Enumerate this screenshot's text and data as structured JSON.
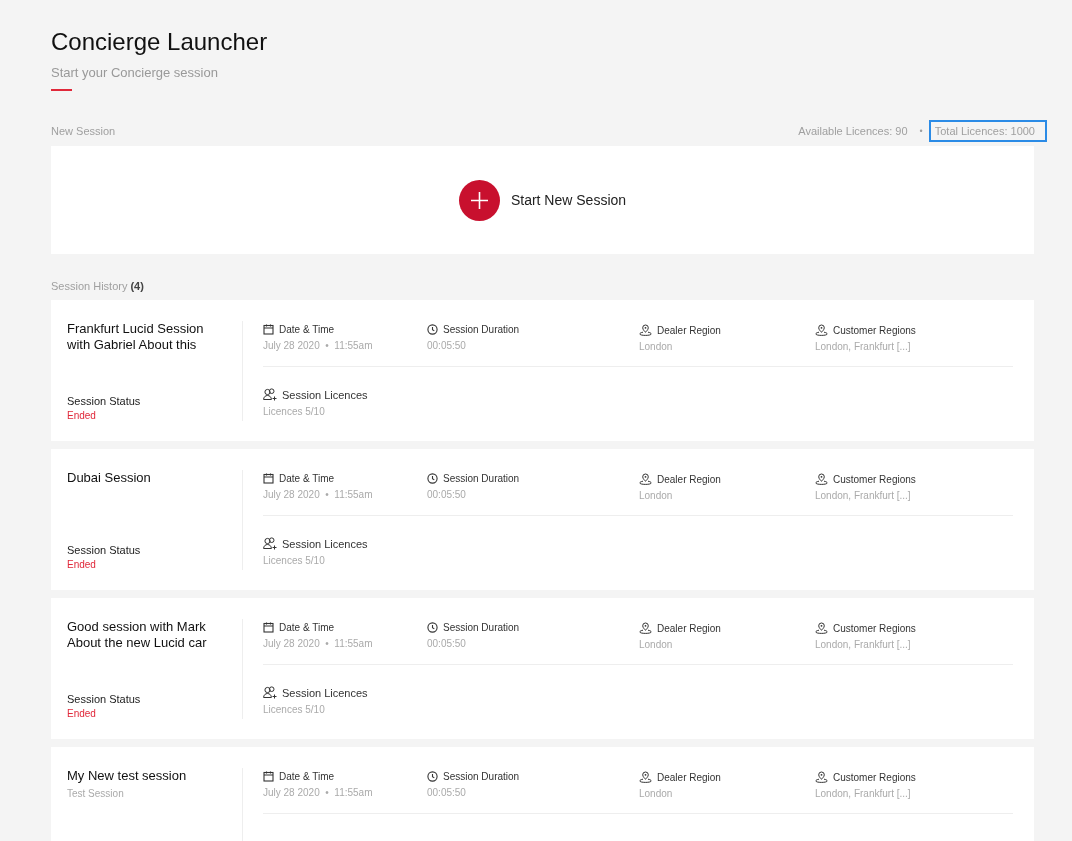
{
  "header": {
    "title": "Concierge Launcher",
    "subtitle": "Start your Concierge session"
  },
  "new_session": {
    "label": "New Session",
    "licences": [
      {
        "text": "Available Licences: 90",
        "highlighted": false
      },
      {
        "text": "Total Licences: 1000",
        "highlighted": true
      }
    ],
    "separator": "•",
    "button": "Start New Session"
  },
  "history": {
    "label": "Session History",
    "count": "(4)",
    "sessions": [
      {
        "title": "Frankfurt Lucid Session with Gabriel About this",
        "fields": [
          {
            "kind": "calendar",
            "label": "Date & Time",
            "value": "July 28 2020  •  11:55am"
          },
          {
            "kind": "clock",
            "label": "Session Duration",
            "value": "00:05:50"
          },
          {
            "kind": "pin",
            "label": "Dealer Region",
            "value": "London"
          },
          {
            "kind": "pin",
            "label": "Customer Regions",
            "value": "London, Frankfurt [...]"
          }
        ],
        "licences": {
          "label": "Session Licences",
          "value": "Licences 5/10"
        },
        "status": {
          "label": "Session Status",
          "value": "Ended"
        }
      },
      {
        "title": "Dubai Session",
        "fields": [
          {
            "kind": "calendar",
            "label": "Date & Time",
            "value": "July 28 2020  •  11:55am"
          },
          {
            "kind": "clock",
            "label": "Session Duration",
            "value": "00:05:50"
          },
          {
            "kind": "pin",
            "label": "Dealer Region",
            "value": "London"
          },
          {
            "kind": "pin",
            "label": "Customer Regions",
            "value": "London, Frankfurt [...]"
          }
        ],
        "licences": {
          "label": "Session Licences",
          "value": "Licences 5/10"
        },
        "status": {
          "label": "Session Status",
          "value": "Ended"
        }
      },
      {
        "title": "Good session with Mark About the new Lucid car",
        "fields": [
          {
            "kind": "calendar",
            "label": "Date & Time",
            "value": "July 28 2020  •  11:55am"
          },
          {
            "kind": "clock",
            "label": "Session Duration",
            "value": "00:05:50"
          },
          {
            "kind": "pin",
            "label": "Dealer Region",
            "value": "London"
          },
          {
            "kind": "pin",
            "label": "Customer Regions",
            "value": "London, Frankfurt [...]"
          }
        ],
        "licences": {
          "label": "Session Licences",
          "value": "Licences 5/10"
        },
        "status": {
          "label": "Session Status",
          "value": "Ended"
        }
      },
      {
        "title": "My New test session",
        "subtitle": "Test Session",
        "fields": [
          {
            "kind": "calendar",
            "label": "Date & Time",
            "value": "July 28 2020  •  11:55am"
          },
          {
            "kind": "clock",
            "label": "Session Duration",
            "value": "00:05:50"
          },
          {
            "kind": "pin",
            "label": "Dealer Region",
            "value": "London"
          },
          {
            "kind": "pin",
            "label": "Customer Regions",
            "value": "London, Frankfurt [...]"
          }
        ]
      }
    ]
  }
}
